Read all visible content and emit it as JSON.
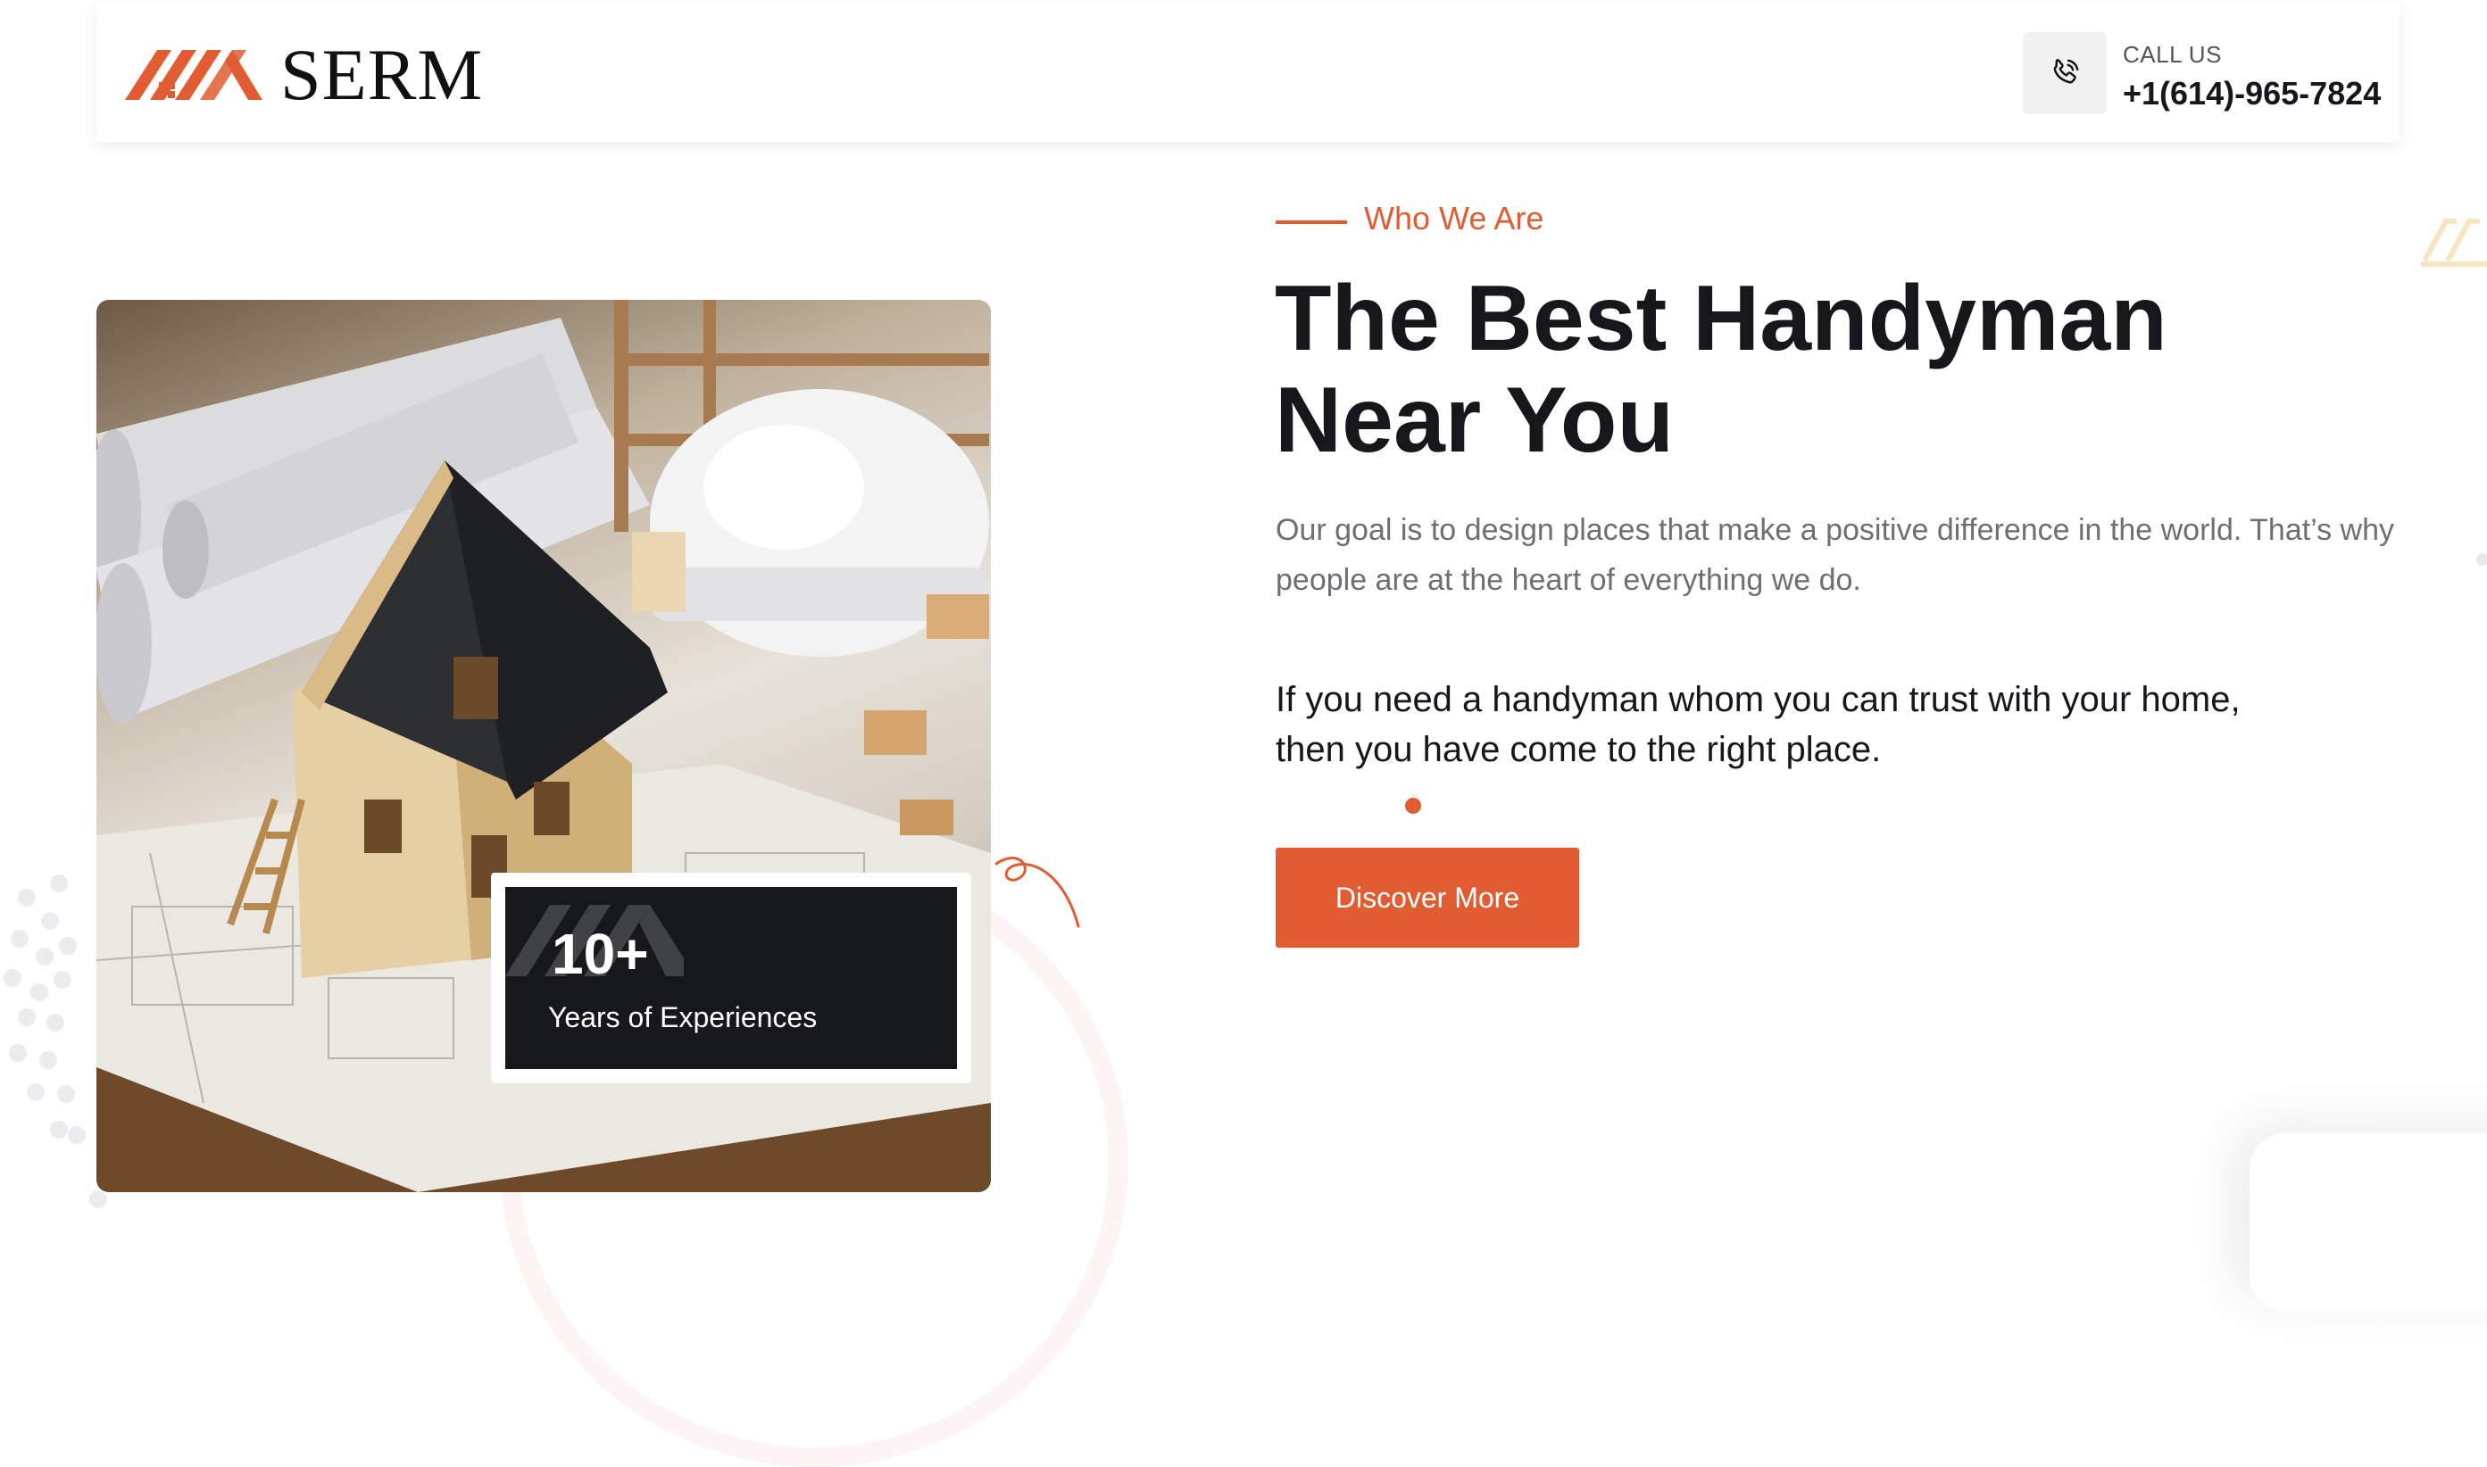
{
  "header": {
    "logo_text": "SERM",
    "call_label": "CALL US",
    "phone": "+1(614)-965-7824"
  },
  "about": {
    "eyebrow": "Who We Are",
    "headline": "The Best Handyman Near You",
    "description": "Our goal is to design places that make a positive difference in the world. That’s why people are at the heart of everything we do.",
    "lead": "If you need a handyman whom you can trust with your home, then you have come to the right place.",
    "cta_label": "Discover More"
  },
  "experience": {
    "number": "10+",
    "label": "Years of Experiences"
  },
  "colors": {
    "accent": "#e15d31",
    "dark": "#17181c",
    "muted_text": "#6e6e73"
  }
}
